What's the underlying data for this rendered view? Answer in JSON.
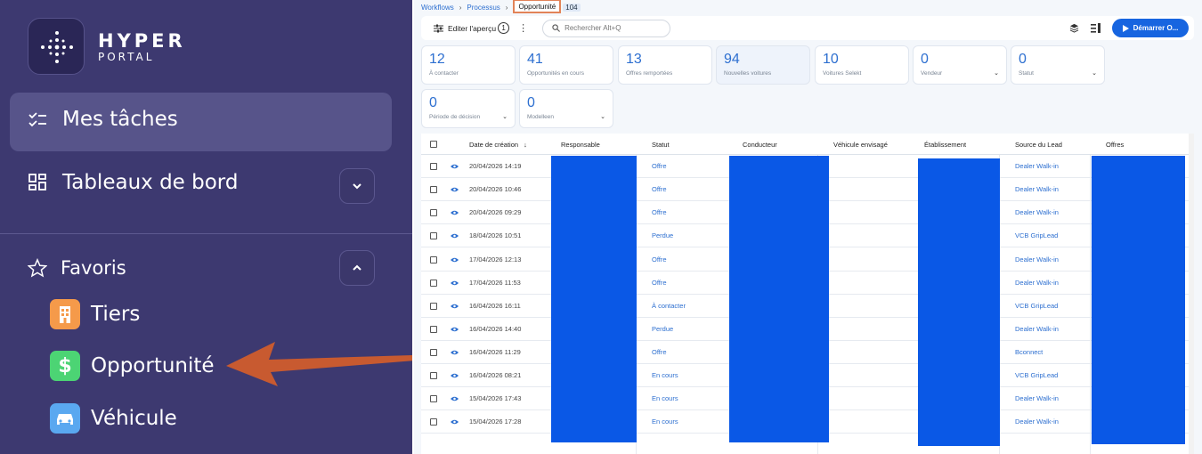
{
  "sidebar": {
    "brand_line1": "HYPER",
    "brand_line2": "PORTAL",
    "items": [
      {
        "label": "Mes tâches",
        "icon": "checklist-icon"
      },
      {
        "label": "Tableaux de bord",
        "icon": "dashboard-icon"
      }
    ],
    "favorites": {
      "label": "Favoris",
      "icon": "star-icon",
      "items": [
        {
          "label": "Tiers",
          "icon": "building-icon",
          "color": "#f59a4a"
        },
        {
          "label": "Opportunité",
          "icon": "dollar-icon",
          "color": "#4cd474"
        },
        {
          "label": "Véhicule",
          "icon": "car-icon",
          "color": "#5aa8f0"
        }
      ]
    }
  },
  "annotation_arrow_color": "#c85a30",
  "breadcrumb": {
    "items": [
      "Workflows",
      "Processus"
    ],
    "current": "Opportunité",
    "count": "104"
  },
  "toolbar": {
    "edit_label": "Editer l'aperçu",
    "edit_badge": "1",
    "search_placeholder": "Rechercher Alt+Q",
    "start_label": "Démarrer O..."
  },
  "kpis_row1": [
    {
      "value": "12",
      "label": "À contacter"
    },
    {
      "value": "41",
      "label": "Opportunités en cours"
    },
    {
      "value": "13",
      "label": "Offres remportées"
    },
    {
      "value": "94",
      "label": "Nouvelles voitures"
    },
    {
      "value": "10",
      "label": "Voitures Selekt"
    },
    {
      "value": "0",
      "label": "Vendeur"
    },
    {
      "value": "0",
      "label": "Statut"
    }
  ],
  "kpis_row2": [
    {
      "value": "0",
      "label": "Période de décision"
    },
    {
      "value": "0",
      "label": "Modelleen"
    }
  ],
  "table": {
    "columns": [
      "Date de création",
      "Responsable",
      "Statut",
      "Conducteur",
      "Véhicule envisagé",
      "Établissement",
      "Source du Lead",
      "Offres"
    ],
    "rows": [
      {
        "date": "20/04/2026 14:19",
        "status": "Offre",
        "source": "Dealer Walk-in"
      },
      {
        "date": "20/04/2026 10:46",
        "status": "Offre",
        "source": "Dealer Walk-in"
      },
      {
        "date": "20/04/2026 09:29",
        "status": "Offre",
        "source": "Dealer Walk-in"
      },
      {
        "date": "18/04/2026 10:51",
        "status": "Perdue",
        "source": "VCB GripLead"
      },
      {
        "date": "17/04/2026 12:13",
        "status": "Offre",
        "source": "Dealer Walk-in"
      },
      {
        "date": "17/04/2026 11:53",
        "status": "Offre",
        "source": "Dealer Walk-in"
      },
      {
        "date": "16/04/2026 16:11",
        "status": "À contacter",
        "source": "VCB GripLead"
      },
      {
        "date": "16/04/2026 14:40",
        "status": "Perdue",
        "source": "Dealer Walk-in"
      },
      {
        "date": "16/04/2026 11:29",
        "status": "Offre",
        "source": "Bconnect"
      },
      {
        "date": "16/04/2026 08:21",
        "status": "En cours",
        "source": "VCB GripLead"
      },
      {
        "date": "15/04/2026 17:43",
        "status": "En cours",
        "source": "Dealer Walk-in"
      },
      {
        "date": "15/04/2026 17:28",
        "status": "En cours",
        "source": "Dealer Walk-in"
      }
    ]
  },
  "colors": {
    "sidebar_bg": "#3d3970",
    "accent": "#1765e0",
    "redaction": "#0a58e6",
    "highlight_box": "#e28358"
  }
}
